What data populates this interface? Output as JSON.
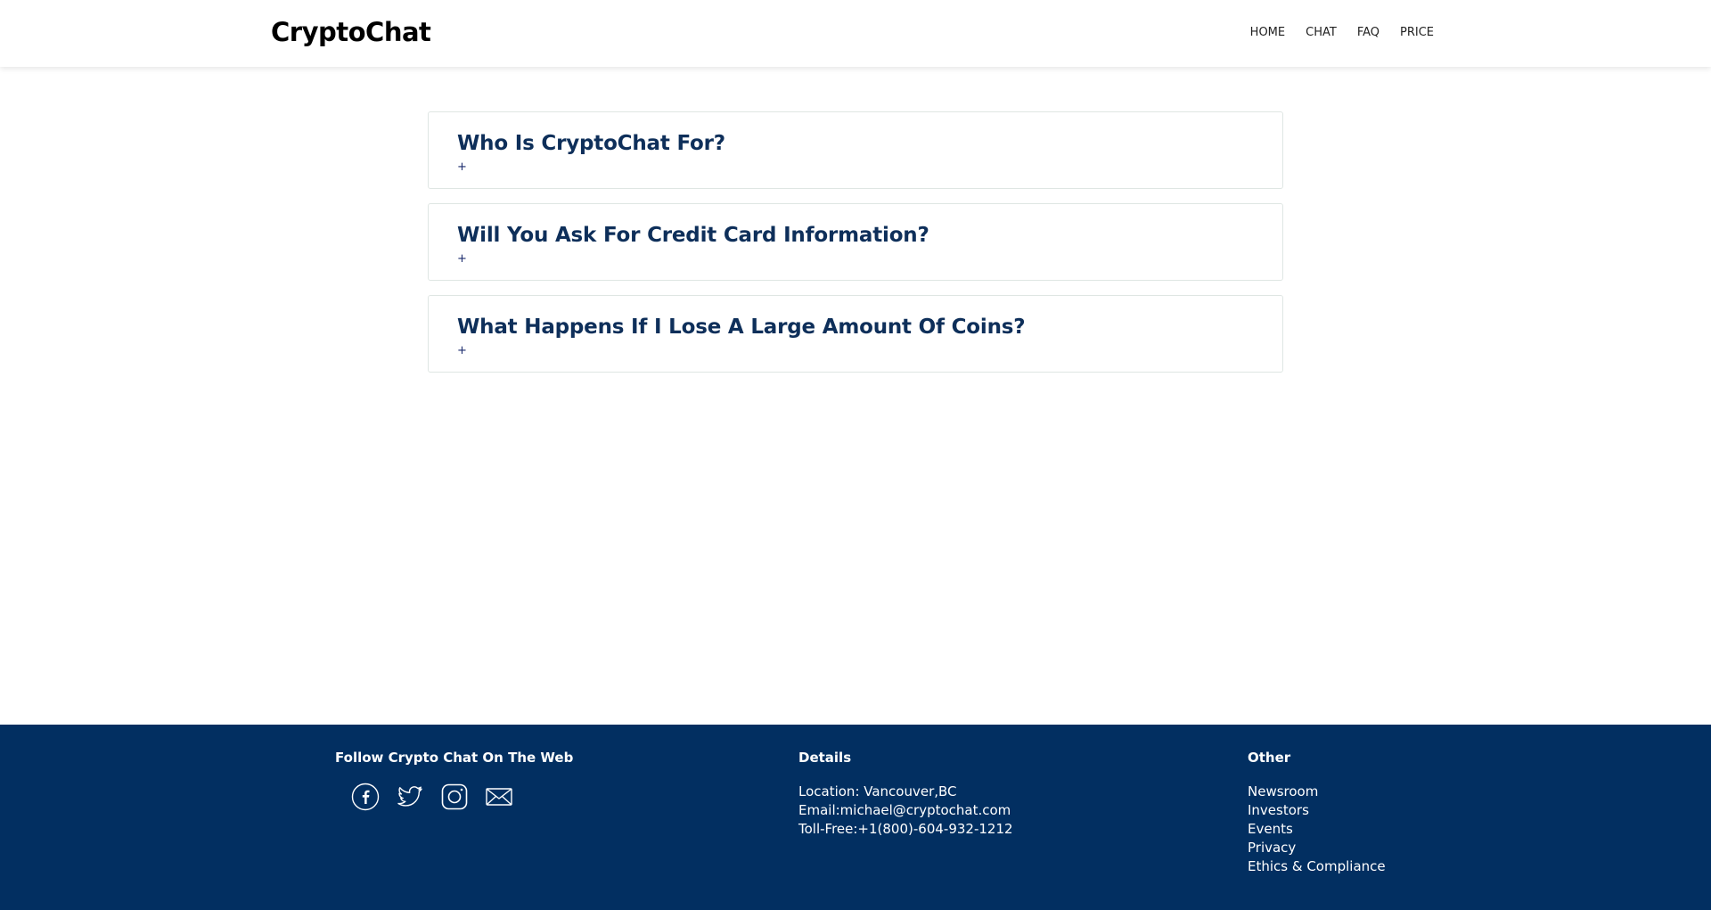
{
  "header": {
    "logo": "CryptoChat",
    "nav": [
      "HOME",
      "CHAT",
      "FAQ",
      "PRICE"
    ]
  },
  "faq": [
    {
      "question": "Who Is CryptoChat For?",
      "toggle": "+"
    },
    {
      "question": "Will You Ask For Credit Card Information?",
      "toggle": "+"
    },
    {
      "question": "What Happens If I Lose A Large Amount Of Coins?",
      "toggle": "+"
    }
  ],
  "footer": {
    "follow": {
      "heading": "Follow Crypto Chat On The Web",
      "icons": [
        "facebook-icon",
        "twitter-icon",
        "instagram-icon",
        "email-icon"
      ]
    },
    "details": {
      "heading": "Details",
      "lines": [
        "Location: Vancouver,BC",
        "Email:michael@cryptochat.com",
        "Toll-Free:+1(800)-604-932-1212"
      ]
    },
    "other": {
      "heading": "Other",
      "links": [
        "Newsroom",
        "Investors",
        "Events",
        "Privacy",
        "Ethics & Compliance"
      ]
    }
  },
  "colors": {
    "accent": "#0e2f5a",
    "footer_bg": "#022f61"
  }
}
